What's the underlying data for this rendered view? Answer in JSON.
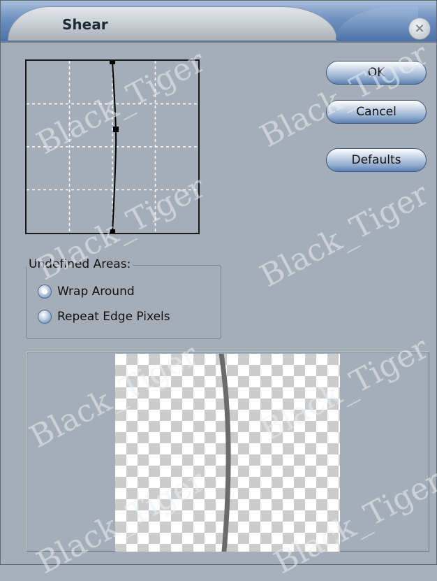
{
  "dialog": {
    "title": "Shear",
    "close_icon": "close-icon"
  },
  "buttons": {
    "ok_label": "OK",
    "cancel_label": "Cancel",
    "defaults_label": "Defaults"
  },
  "undefined_areas": {
    "legend": "Undefined Areas:",
    "options": [
      {
        "label": "Wrap Around",
        "selected": true
      },
      {
        "label": "Repeat Edge Pixels",
        "selected": false
      }
    ]
  },
  "watermark": {
    "text": "Black_Tiger"
  },
  "colors": {
    "dialog_bg": "#a5aeb8",
    "title_blue": "#5073a7",
    "preview_line": "#6b6b6b"
  }
}
